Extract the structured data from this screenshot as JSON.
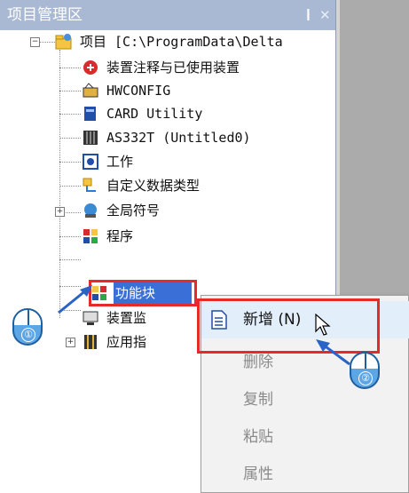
{
  "panel": {
    "title": "项目管理区",
    "pin_icon": "pin-icon",
    "close_icon": "close-icon"
  },
  "tree": {
    "root_label": "项目 [C:\\ProgramData\\Delta",
    "items": [
      {
        "label": "装置注释与已使用装置",
        "icon": "device-comment-icon"
      },
      {
        "label": "HWCONFIG",
        "icon": "hwconfig-icon"
      },
      {
        "label": "CARD Utility",
        "icon": "card-utility-icon"
      },
      {
        "label": "AS332T  (Untitled0)",
        "icon": "plc-icon"
      },
      {
        "label": "工作",
        "icon": "task-icon"
      },
      {
        "label": "自定义数据类型",
        "icon": "data-type-icon"
      },
      {
        "label": "全局符号",
        "icon": "global-symbol-icon"
      },
      {
        "label": "程序",
        "icon": "program-icon"
      },
      {
        "label": "功能块",
        "icon": "function-block-icon"
      },
      {
        "label": "装置监",
        "icon": "device-monitor-icon"
      },
      {
        "label": "应用指",
        "icon": "instruction-icon"
      }
    ]
  },
  "context_menu": {
    "items": [
      {
        "label": "新增 (N)",
        "icon": "new-document-icon"
      },
      {
        "label": "删除"
      },
      {
        "label": "复制"
      },
      {
        "label": "粘贴"
      },
      {
        "label": "属性"
      }
    ]
  },
  "callouts": {
    "step1": "①",
    "step2": "②"
  },
  "colors": {
    "title_bar": "#a9b9d3",
    "highlight_red": "#e52a2a",
    "selection_blue": "#3a6fd8",
    "callout_blue": "#5da6e6"
  }
}
